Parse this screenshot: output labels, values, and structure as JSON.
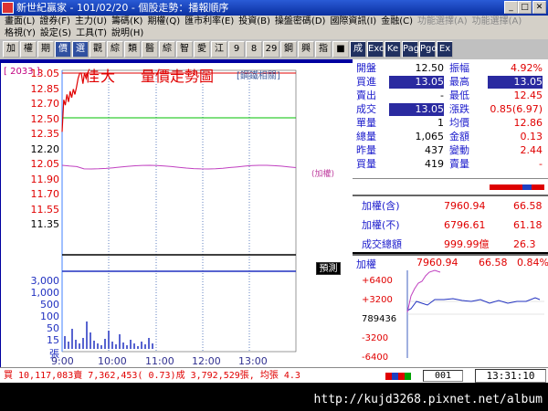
{
  "window": {
    "title": "新世紀贏家 - 101/02/20 - 個股走勢：播報順序"
  },
  "menu": {
    "row1": [
      "畫面(L)",
      "證券(F)",
      "主力(U)",
      "籌碼(K)",
      "期權(Q)",
      "匯市利率(E)",
      "投資(B)",
      "操盤密碼(D)",
      "國際資訊(I)",
      "金融(C)",
      "功能選擇(A)",
      "功能選擇(A)"
    ],
    "row2": [
      "格視(Y)",
      "設定(S)",
      "工具(T)",
      "說明(H)"
    ]
  },
  "toolbar": [
    "加",
    "權",
    "期",
    "價",
    "選",
    "觀",
    "綜",
    "類",
    "醫",
    "綜",
    "智",
    "愛",
    "江",
    "9",
    "8",
    "29",
    "鋼",
    "興",
    "指",
    "■",
    "成",
    "Exc",
    "Ke",
    "Page",
    "Pgo",
    "Ex"
  ],
  "chart": {
    "code": "[ 2033 ]",
    "stock_name": "佳大",
    "title": "量價走勢圖",
    "category": "[鋼鐵相關]",
    "price_labels": [
      "13.05",
      "12.85",
      "12.70",
      "12.50",
      "12.35",
      "12.20",
      "12.05",
      "11.90",
      "11.70",
      "11.55",
      "11.35"
    ],
    "volume_labels": [
      "3,000",
      "1,000",
      "500",
      "100",
      "50",
      "15",
      "張"
    ],
    "time_labels": [
      "9:00",
      "10:00",
      "11:00",
      "12:00",
      "13:00"
    ],
    "index_label": "(加權)",
    "vol_button": "預測"
  },
  "chart_data": {
    "type": "line",
    "title": "量價走勢圖",
    "x": [
      "9:00",
      "9:05",
      "9:10",
      "9:15",
      "9:20",
      "9:25",
      "9:30",
      "9:35",
      "9:40",
      "9:45",
      "9:50",
      "9:55",
      "10:00",
      "10:05",
      "10:10",
      "10:15",
      "10:20"
    ],
    "series": [
      {
        "values": [
          12.5,
          12.8,
          12.75,
          12.85,
          12.78,
          12.88,
          12.82,
          12.9,
          12.85,
          12.92,
          13.0,
          13.05,
          13.05,
          12.95,
          13.05,
          13.0,
          13.05
        ]
      }
    ],
    "ylim": [
      11.35,
      13.05
    ],
    "reference_price": 12.2,
    "limit_up": 13.05
  },
  "quote": {
    "rows": [
      {
        "k1": "開盤",
        "v1": "12.50",
        "k2": "振幅",
        "v2": "4.92%",
        "c1": "#000",
        "c2": "#e00000"
      },
      {
        "k1": "買進",
        "v1": "13.05",
        "k2": "最高",
        "v2": "13.05",
        "c1": "#fff",
        "c2": "#fff",
        "hl1": true,
        "hl2": true
      },
      {
        "k1": "賣出",
        "v1": "-",
        "k2": "最低",
        "v2": "12.45",
        "c1": "#000",
        "c2": "#e00000"
      },
      {
        "k1": "成交",
        "v1": "13.05",
        "k2": "漲跌",
        "v2": "0.85(6.97)",
        "c1": "#fff",
        "c2": "#e00000",
        "hl1": true
      },
      {
        "k1": "單量",
        "v1": "1",
        "k2": "均價",
        "v2": "12.86",
        "c1": "#000",
        "c2": "#e00000"
      },
      {
        "k1": "總量",
        "v1": "1,065",
        "k2": "金額",
        "v2": "0.13",
        "c1": "#000",
        "c2": "#e00000"
      },
      {
        "k1": "昨量",
        "v1": "437",
        "k2": "變動",
        "v2": "2.44",
        "c1": "#000",
        "c2": "#e00000"
      },
      {
        "k1": "買量",
        "v1": "419",
        "k2": "賣量",
        "v2": "-",
        "c1": "#000",
        "c2": "#e00000"
      }
    ]
  },
  "index": {
    "rows": [
      {
        "label": "加權(含)",
        "value": "7960.94",
        "change": "66.58"
      },
      {
        "label": "加權(不)",
        "value": "6796.61",
        "change": "61.18"
      },
      {
        "label": "成交總額",
        "value": "999.99億",
        "change": "26.3"
      }
    ]
  },
  "mini": {
    "label": "加權",
    "value": "7960.94",
    "change": "66.58",
    "pct": "0.84%",
    "ticks": [
      "+6400",
      "+3200",
      "789436",
      "-3200",
      "-6400"
    ]
  },
  "status": {
    "text": "買 10,117,083賣 7,362,453( 0.73)成 3,792,529張, 均張 4.3",
    "count": "001",
    "clock": "13:31:10"
  },
  "watermark": {
    "url": "http://kujd3268.pixnet.net/album"
  }
}
